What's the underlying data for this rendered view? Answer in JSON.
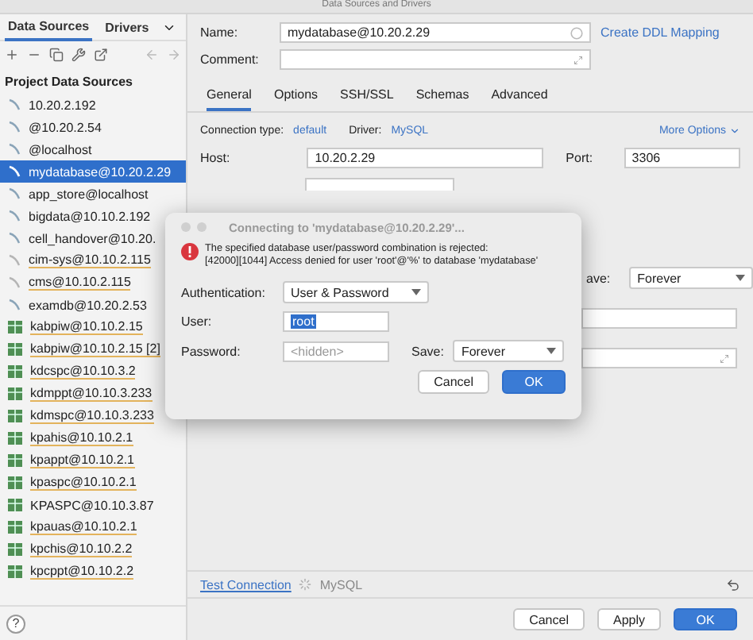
{
  "window": {
    "title": "Data Sources and Drivers"
  },
  "sidebar": {
    "tabs": [
      {
        "label": "Data Sources",
        "selected": true
      },
      {
        "label": "Drivers",
        "selected": false
      }
    ],
    "section_title": "Project Data Sources",
    "items": [
      {
        "label": "10.20.2.192",
        "kind": "plain",
        "selected": false,
        "underlined": false
      },
      {
        "label": "@10.20.2.54",
        "kind": "plain",
        "selected": false,
        "underlined": false
      },
      {
        "label": "@localhost",
        "kind": "plain",
        "selected": false,
        "underlined": false
      },
      {
        "label": "mydatabase@10.20.2.29",
        "kind": "plain",
        "selected": true,
        "underlined": false
      },
      {
        "label": "app_store@localhost",
        "kind": "plain",
        "selected": false,
        "underlined": false
      },
      {
        "label": "bigdata@10.10.2.192",
        "kind": "plain",
        "selected": false,
        "underlined": false
      },
      {
        "label": "cell_handover@10.20.",
        "kind": "plain",
        "selected": false,
        "underlined": false
      },
      {
        "label": "cim-sys@10.10.2.115",
        "kind": "faded",
        "selected": false,
        "underlined": true
      },
      {
        "label": "cms@10.10.2.115",
        "kind": "faded",
        "selected": false,
        "underlined": true
      },
      {
        "label": "examdb@10.20.2.53",
        "kind": "plain",
        "selected": false,
        "underlined": false
      },
      {
        "label": "kabpiw@10.10.2.15",
        "kind": "grid",
        "selected": false,
        "underlined": true
      },
      {
        "label": "kabpiw@10.10.2.15 [2]",
        "kind": "grid",
        "selected": false,
        "underlined": true
      },
      {
        "label": "kdcspc@10.10.3.2",
        "kind": "grid",
        "selected": false,
        "underlined": true
      },
      {
        "label": "kdmppt@10.10.3.233",
        "kind": "grid",
        "selected": false,
        "underlined": true
      },
      {
        "label": "kdmspc@10.10.3.233",
        "kind": "grid",
        "selected": false,
        "underlined": true
      },
      {
        "label": "kpahis@10.10.2.1",
        "kind": "grid",
        "selected": false,
        "underlined": true
      },
      {
        "label": "kpappt@10.10.2.1",
        "kind": "grid",
        "selected": false,
        "underlined": true
      },
      {
        "label": "kpaspc@10.10.2.1",
        "kind": "grid",
        "selected": false,
        "underlined": true
      },
      {
        "label": "KPASPC@10.10.3.87",
        "kind": "grid",
        "selected": false,
        "underlined": false
      },
      {
        "label": "kpauas@10.10.2.1",
        "kind": "grid",
        "selected": false,
        "underlined": true
      },
      {
        "label": "kpchis@10.10.2.2",
        "kind": "grid",
        "selected": false,
        "underlined": true
      },
      {
        "label": "kpcppt@10.10.2.2",
        "kind": "grid",
        "selected": false,
        "underlined": true
      }
    ],
    "help": "?"
  },
  "connection": {
    "name_label": "Name:",
    "name": "mydatabase@10.20.2.29",
    "ddl_link": "Create DDL Mapping",
    "comment_label": "Comment:",
    "tabs": [
      {
        "label": "General",
        "selected": true
      },
      {
        "label": "Options",
        "selected": false
      },
      {
        "label": "SSH/SSL",
        "selected": false
      },
      {
        "label": "Schemas",
        "selected": false
      },
      {
        "label": "Advanced",
        "selected": false
      }
    ],
    "connection_type_label": "Connection type:",
    "connection_type": "default",
    "driver_label": "Driver:",
    "driver": "MySQL",
    "more_options": "More Options",
    "host_label": "Host:",
    "host": "10.20.2.29",
    "port_label": "Port:",
    "port": "3306",
    "save_label": "ave:",
    "save": "Forever"
  },
  "footer": {
    "test_connection": "Test Connection",
    "driver_status": "MySQL",
    "buttons": [
      {
        "label": "Cancel",
        "primary": false
      },
      {
        "label": "Apply",
        "primary": false
      },
      {
        "label": "OK",
        "primary": true
      }
    ]
  },
  "dialog": {
    "title": "Connecting to 'mydatabase@10.20.2.29'...",
    "message": [
      "The specified database user/password combination is rejected:",
      "[42000][1044] Access denied for user 'root'@'%' to database 'mydatabase'"
    ],
    "auth_label": "Authentication:",
    "auth": "User & Password",
    "user_label": "User:",
    "user": "root",
    "password_label": "Password:",
    "password_placeholder": "<hidden>",
    "save_label": "Save:",
    "save": "Forever",
    "buttons": [
      {
        "label": "Cancel",
        "primary": false
      },
      {
        "label": "OK",
        "primary": true
      }
    ]
  }
}
